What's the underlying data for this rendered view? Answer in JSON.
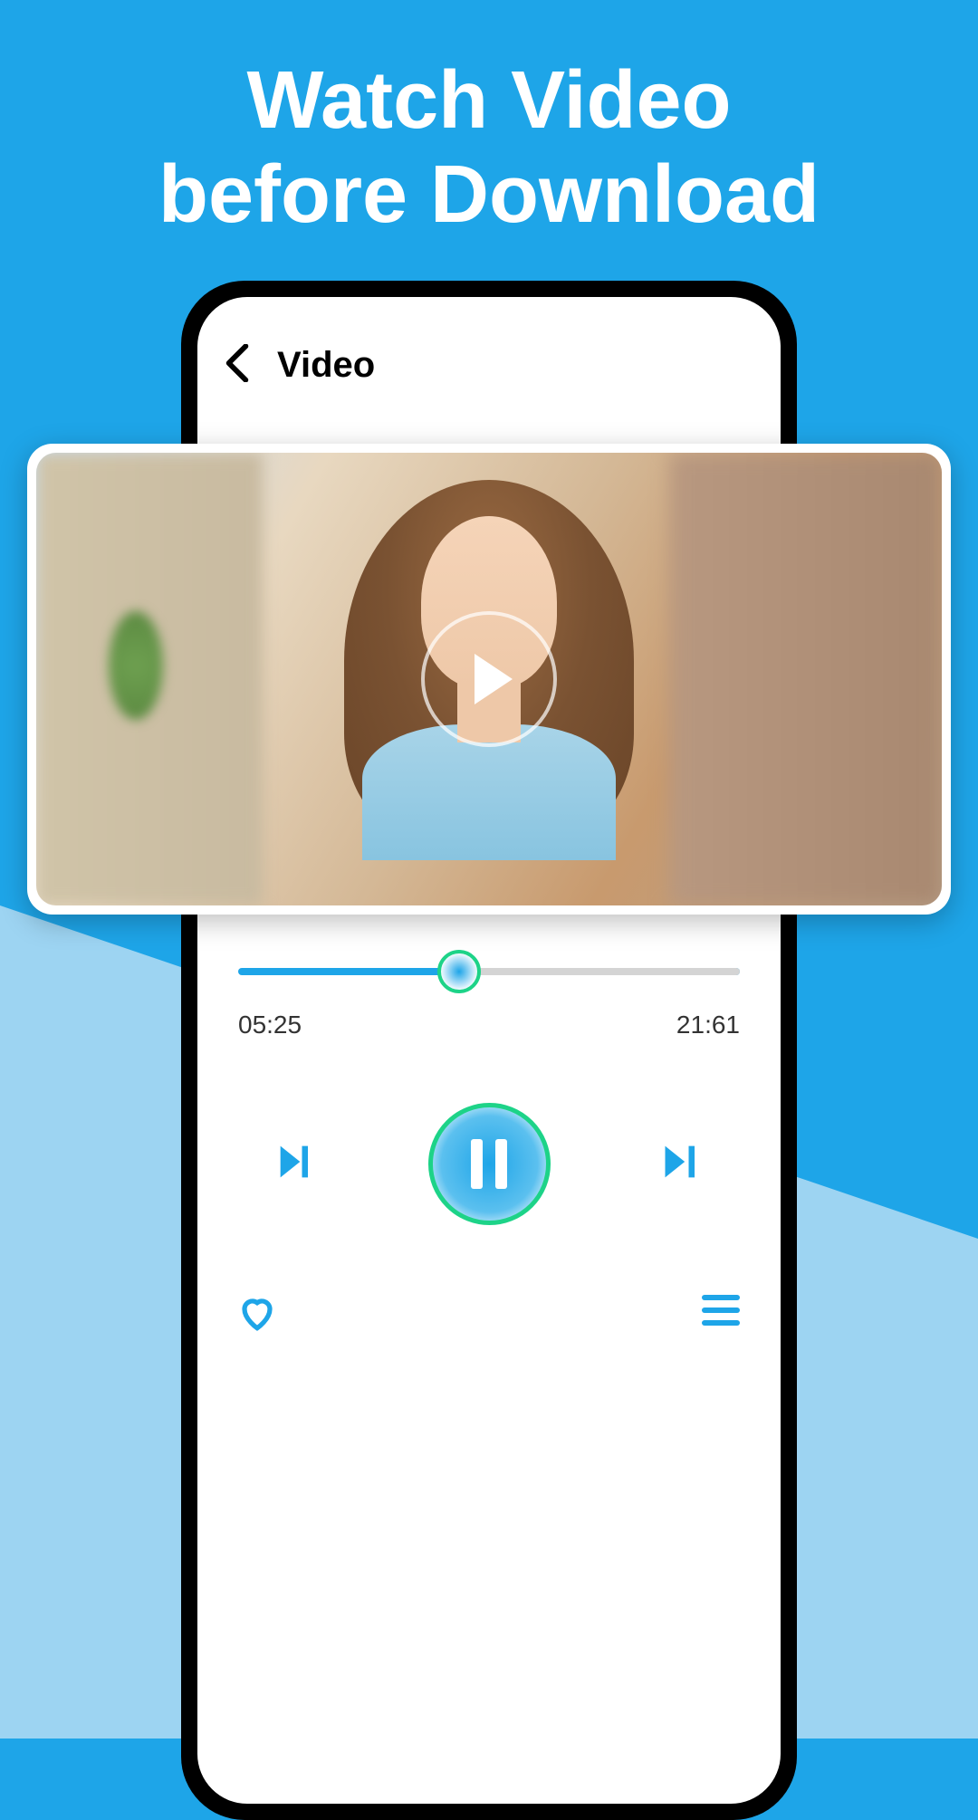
{
  "promo": {
    "title_line1": "Watch Video",
    "title_line2": "before Download"
  },
  "header": {
    "page_title": "Video"
  },
  "player": {
    "current_time": "05:25",
    "total_time": "21:61",
    "progress_percent": 44
  },
  "colors": {
    "primary": "#1ea5e8",
    "accent": "#1dd388",
    "bg_light": "#9dd4f2"
  },
  "icons": {
    "back": "chevron-left",
    "play": "play",
    "pause": "pause",
    "prev": "skip-previous",
    "next": "skip-next",
    "heart": "heart",
    "menu": "menu"
  }
}
